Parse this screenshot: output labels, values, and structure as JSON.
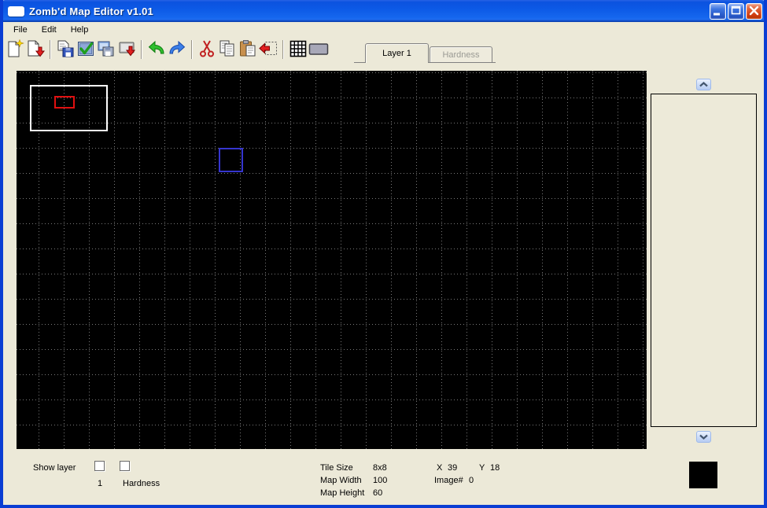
{
  "window": {
    "title": "Zomb'd Map Editor v1.01",
    "controls": [
      "minimize-button",
      "maximize-button",
      "close-button"
    ]
  },
  "menu": {
    "items": [
      {
        "label": "File"
      },
      {
        "label": "Edit"
      },
      {
        "label": "Help"
      }
    ]
  },
  "toolbar": {
    "icons": [
      "new-icon",
      "open-icon",
      "save-icon",
      "apply-icon",
      "save-as-icon",
      "export-icon",
      "undo-icon",
      "redo-icon",
      "cut-icon",
      "copy-icon",
      "paste-icon",
      "paste-selection-icon",
      "grid-icon",
      "tile-icon"
    ]
  },
  "tabs": {
    "items": [
      {
        "label": "Layer 1",
        "active": true
      },
      {
        "label": "Hardness",
        "active": false
      }
    ]
  },
  "canvas": {
    "background": "#000000",
    "grid_color": "#787878",
    "shapes": [
      {
        "name": "white-selection-outline",
        "color": "#FFFFFF"
      },
      {
        "name": "red-tile-marker",
        "color": "#E01010"
      },
      {
        "name": "blue-tile-cursor",
        "color": "#3535CE"
      }
    ]
  },
  "sidebar": {
    "swatch_color": "#000000"
  },
  "status": {
    "show_layer_label": "Show layer",
    "layers": [
      {
        "label": "1",
        "checked": false
      },
      {
        "label": "Hardness",
        "checked": false
      }
    ],
    "tile_size": {
      "label": "Tile Size",
      "value": "8x8"
    },
    "map_width": {
      "label": "Map Width",
      "value": "100"
    },
    "map_height": {
      "label": "Map Height",
      "value": "60"
    },
    "cursor": {
      "x_label": "X",
      "x": "39",
      "y_label": "Y",
      "y": "18"
    },
    "image": {
      "label": "Image#",
      "value": "0"
    }
  },
  "colors": {
    "titlebar_blue": "#0D5BE7",
    "window_border": "#0A3DD3",
    "background": "#ECE9D8"
  }
}
